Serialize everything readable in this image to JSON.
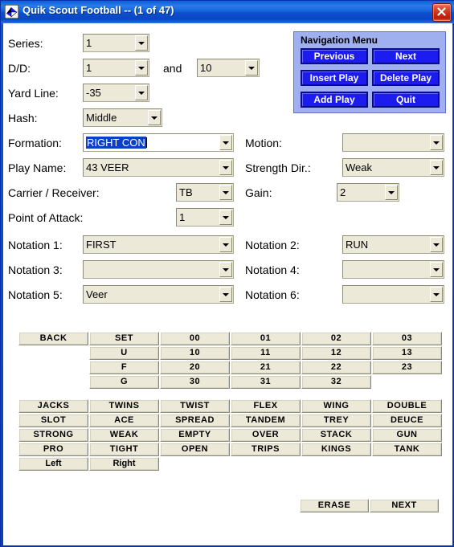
{
  "window": {
    "title": "Quik Scout Football -- (1 of 47)",
    "icon": "app-football-icon",
    "close_icon": "close-icon",
    "titlebar_color": "#0A58D6",
    "close_color": "#CE2D17"
  },
  "form": {
    "fields": [
      {
        "label": "Series:",
        "value": "1"
      },
      {
        "label": "D/D:",
        "value": "1"
      },
      {
        "label": "and",
        "value": "10"
      },
      {
        "label": "Yard Line:",
        "value": "-35"
      },
      {
        "label": "Hash:",
        "value": "Middle"
      },
      {
        "label": "Formation:",
        "value": "RIGHT CON"
      },
      {
        "label": "Play Name:",
        "value": "43 VEER"
      },
      {
        "label": "Carrier / Receiver:",
        "value": "TB"
      },
      {
        "label": "Point of Attack:",
        "value": "1"
      },
      {
        "label": "Motion:",
        "value": ""
      },
      {
        "label": "Strength Dir.:",
        "value": "Weak"
      },
      {
        "label": "Gain:",
        "value": "2"
      },
      {
        "label": "Notation 1:",
        "value": "FIRST"
      },
      {
        "label": "Notation 2:",
        "value": "RUN"
      },
      {
        "label": "Notation 3:",
        "value": ""
      },
      {
        "label": "Notation 4:",
        "value": ""
      },
      {
        "label": "Notation 5:",
        "value": "Veer"
      },
      {
        "label": "Notation 6:",
        "value": ""
      }
    ]
  },
  "navigation": {
    "title": "Navigation Menu",
    "accent_color": "#1C1CEE",
    "panel_color": "#9FAFEF",
    "buttons": [
      {
        "label": "Previous"
      },
      {
        "label": "Next"
      },
      {
        "label": "Insert Play"
      },
      {
        "label": "Delete Play"
      },
      {
        "label": "Add Play"
      },
      {
        "label": "Quit"
      }
    ]
  },
  "backfield_grid": {
    "rows": [
      [
        "BACK",
        "SET",
        "00",
        "01",
        "02",
        "03"
      ],
      [
        "",
        "U",
        "10",
        "11",
        "12",
        "13"
      ],
      [
        "",
        "F",
        "20",
        "21",
        "22",
        "23"
      ],
      [
        "",
        "G",
        "30",
        "31",
        "32",
        ""
      ]
    ]
  },
  "formation_grid": {
    "rows": [
      [
        "JACKS",
        "TWINS",
        "TWIST",
        "FLEX",
        "WING",
        "DOUBLE"
      ],
      [
        "SLOT",
        "ACE",
        "SPREAD",
        "TANDEM",
        "TREY",
        "DEUCE"
      ],
      [
        "STRONG",
        "WEAK",
        "EMPTY",
        "OVER",
        "STACK",
        "GUN"
      ],
      [
        "PRO",
        "TIGHT",
        "OPEN",
        "TRIPS",
        "KINGS",
        "TANK"
      ],
      [
        "Left",
        "Right",
        "",
        "",
        "",
        ""
      ]
    ]
  },
  "footer": {
    "buttons": [
      {
        "label": "ERASE"
      },
      {
        "label": "NEXT"
      }
    ]
  }
}
